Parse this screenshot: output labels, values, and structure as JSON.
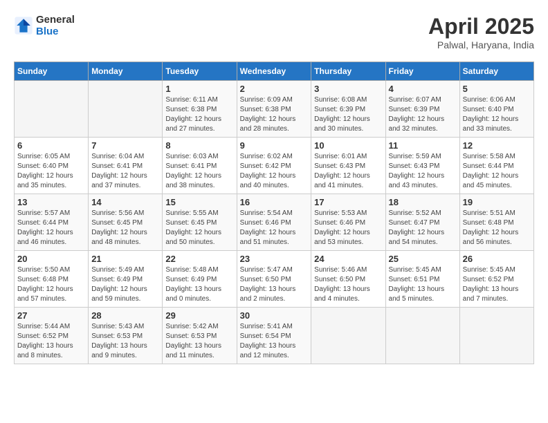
{
  "header": {
    "logo_line1": "General",
    "logo_line2": "Blue",
    "title": "April 2025",
    "subtitle": "Palwal, Haryana, India"
  },
  "columns": [
    "Sunday",
    "Monday",
    "Tuesday",
    "Wednesday",
    "Thursday",
    "Friday",
    "Saturday"
  ],
  "weeks": [
    [
      {
        "day": "",
        "sunrise": "",
        "sunset": "",
        "daylight": ""
      },
      {
        "day": "",
        "sunrise": "",
        "sunset": "",
        "daylight": ""
      },
      {
        "day": "1",
        "sunrise": "Sunrise: 6:11 AM",
        "sunset": "Sunset: 6:38 PM",
        "daylight": "Daylight: 12 hours and 27 minutes."
      },
      {
        "day": "2",
        "sunrise": "Sunrise: 6:09 AM",
        "sunset": "Sunset: 6:38 PM",
        "daylight": "Daylight: 12 hours and 28 minutes."
      },
      {
        "day": "3",
        "sunrise": "Sunrise: 6:08 AM",
        "sunset": "Sunset: 6:39 PM",
        "daylight": "Daylight: 12 hours and 30 minutes."
      },
      {
        "day": "4",
        "sunrise": "Sunrise: 6:07 AM",
        "sunset": "Sunset: 6:39 PM",
        "daylight": "Daylight: 12 hours and 32 minutes."
      },
      {
        "day": "5",
        "sunrise": "Sunrise: 6:06 AM",
        "sunset": "Sunset: 6:40 PM",
        "daylight": "Daylight: 12 hours and 33 minutes."
      }
    ],
    [
      {
        "day": "6",
        "sunrise": "Sunrise: 6:05 AM",
        "sunset": "Sunset: 6:40 PM",
        "daylight": "Daylight: 12 hours and 35 minutes."
      },
      {
        "day": "7",
        "sunrise": "Sunrise: 6:04 AM",
        "sunset": "Sunset: 6:41 PM",
        "daylight": "Daylight: 12 hours and 37 minutes."
      },
      {
        "day": "8",
        "sunrise": "Sunrise: 6:03 AM",
        "sunset": "Sunset: 6:41 PM",
        "daylight": "Daylight: 12 hours and 38 minutes."
      },
      {
        "day": "9",
        "sunrise": "Sunrise: 6:02 AM",
        "sunset": "Sunset: 6:42 PM",
        "daylight": "Daylight: 12 hours and 40 minutes."
      },
      {
        "day": "10",
        "sunrise": "Sunrise: 6:01 AM",
        "sunset": "Sunset: 6:43 PM",
        "daylight": "Daylight: 12 hours and 41 minutes."
      },
      {
        "day": "11",
        "sunrise": "Sunrise: 5:59 AM",
        "sunset": "Sunset: 6:43 PM",
        "daylight": "Daylight: 12 hours and 43 minutes."
      },
      {
        "day": "12",
        "sunrise": "Sunrise: 5:58 AM",
        "sunset": "Sunset: 6:44 PM",
        "daylight": "Daylight: 12 hours and 45 minutes."
      }
    ],
    [
      {
        "day": "13",
        "sunrise": "Sunrise: 5:57 AM",
        "sunset": "Sunset: 6:44 PM",
        "daylight": "Daylight: 12 hours and 46 minutes."
      },
      {
        "day": "14",
        "sunrise": "Sunrise: 5:56 AM",
        "sunset": "Sunset: 6:45 PM",
        "daylight": "Daylight: 12 hours and 48 minutes."
      },
      {
        "day": "15",
        "sunrise": "Sunrise: 5:55 AM",
        "sunset": "Sunset: 6:45 PM",
        "daylight": "Daylight: 12 hours and 50 minutes."
      },
      {
        "day": "16",
        "sunrise": "Sunrise: 5:54 AM",
        "sunset": "Sunset: 6:46 PM",
        "daylight": "Daylight: 12 hours and 51 minutes."
      },
      {
        "day": "17",
        "sunrise": "Sunrise: 5:53 AM",
        "sunset": "Sunset: 6:46 PM",
        "daylight": "Daylight: 12 hours and 53 minutes."
      },
      {
        "day": "18",
        "sunrise": "Sunrise: 5:52 AM",
        "sunset": "Sunset: 6:47 PM",
        "daylight": "Daylight: 12 hours and 54 minutes."
      },
      {
        "day": "19",
        "sunrise": "Sunrise: 5:51 AM",
        "sunset": "Sunset: 6:48 PM",
        "daylight": "Daylight: 12 hours and 56 minutes."
      }
    ],
    [
      {
        "day": "20",
        "sunrise": "Sunrise: 5:50 AM",
        "sunset": "Sunset: 6:48 PM",
        "daylight": "Daylight: 12 hours and 57 minutes."
      },
      {
        "day": "21",
        "sunrise": "Sunrise: 5:49 AM",
        "sunset": "Sunset: 6:49 PM",
        "daylight": "Daylight: 12 hours and 59 minutes."
      },
      {
        "day": "22",
        "sunrise": "Sunrise: 5:48 AM",
        "sunset": "Sunset: 6:49 PM",
        "daylight": "Daylight: 13 hours and 0 minutes."
      },
      {
        "day": "23",
        "sunrise": "Sunrise: 5:47 AM",
        "sunset": "Sunset: 6:50 PM",
        "daylight": "Daylight: 13 hours and 2 minutes."
      },
      {
        "day": "24",
        "sunrise": "Sunrise: 5:46 AM",
        "sunset": "Sunset: 6:50 PM",
        "daylight": "Daylight: 13 hours and 4 minutes."
      },
      {
        "day": "25",
        "sunrise": "Sunrise: 5:45 AM",
        "sunset": "Sunset: 6:51 PM",
        "daylight": "Daylight: 13 hours and 5 minutes."
      },
      {
        "day": "26",
        "sunrise": "Sunrise: 5:45 AM",
        "sunset": "Sunset: 6:52 PM",
        "daylight": "Daylight: 13 hours and 7 minutes."
      }
    ],
    [
      {
        "day": "27",
        "sunrise": "Sunrise: 5:44 AM",
        "sunset": "Sunset: 6:52 PM",
        "daylight": "Daylight: 13 hours and 8 minutes."
      },
      {
        "day": "28",
        "sunrise": "Sunrise: 5:43 AM",
        "sunset": "Sunset: 6:53 PM",
        "daylight": "Daylight: 13 hours and 9 minutes."
      },
      {
        "day": "29",
        "sunrise": "Sunrise: 5:42 AM",
        "sunset": "Sunset: 6:53 PM",
        "daylight": "Daylight: 13 hours and 11 minutes."
      },
      {
        "day": "30",
        "sunrise": "Sunrise: 5:41 AM",
        "sunset": "Sunset: 6:54 PM",
        "daylight": "Daylight: 13 hours and 12 minutes."
      },
      {
        "day": "",
        "sunrise": "",
        "sunset": "",
        "daylight": ""
      },
      {
        "day": "",
        "sunrise": "",
        "sunset": "",
        "daylight": ""
      },
      {
        "day": "",
        "sunrise": "",
        "sunset": "",
        "daylight": ""
      }
    ]
  ]
}
